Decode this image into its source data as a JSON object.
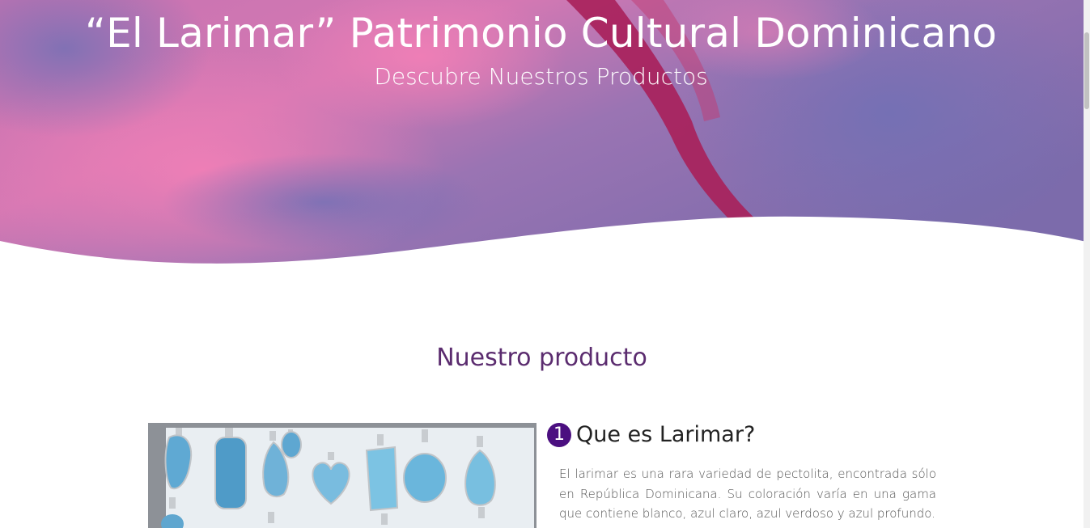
{
  "hero": {
    "title": "“El Larimar” Patrimonio Cultural Dominicano",
    "subtitle": "Descubre Nuestros Productos"
  },
  "section": {
    "title": "Nuestro producto"
  },
  "feature": {
    "number": "1",
    "title": "Que es Larimar?",
    "text": "El larimar es una rara variedad de pectolita, encontrada sólo en República Dominicana. Su coloración varía en una gama que contiene blanco, azul claro, azul verdoso y azul profundo."
  },
  "colors": {
    "hero_purple": "#7d6aad",
    "hero_pink": "#e67ab0",
    "hero_magenta": "#a8205a",
    "section_title": "#5b2c6f",
    "badge": "#4b0f80"
  },
  "icons": {
    "product_image": "larimar-pendants-photo"
  }
}
